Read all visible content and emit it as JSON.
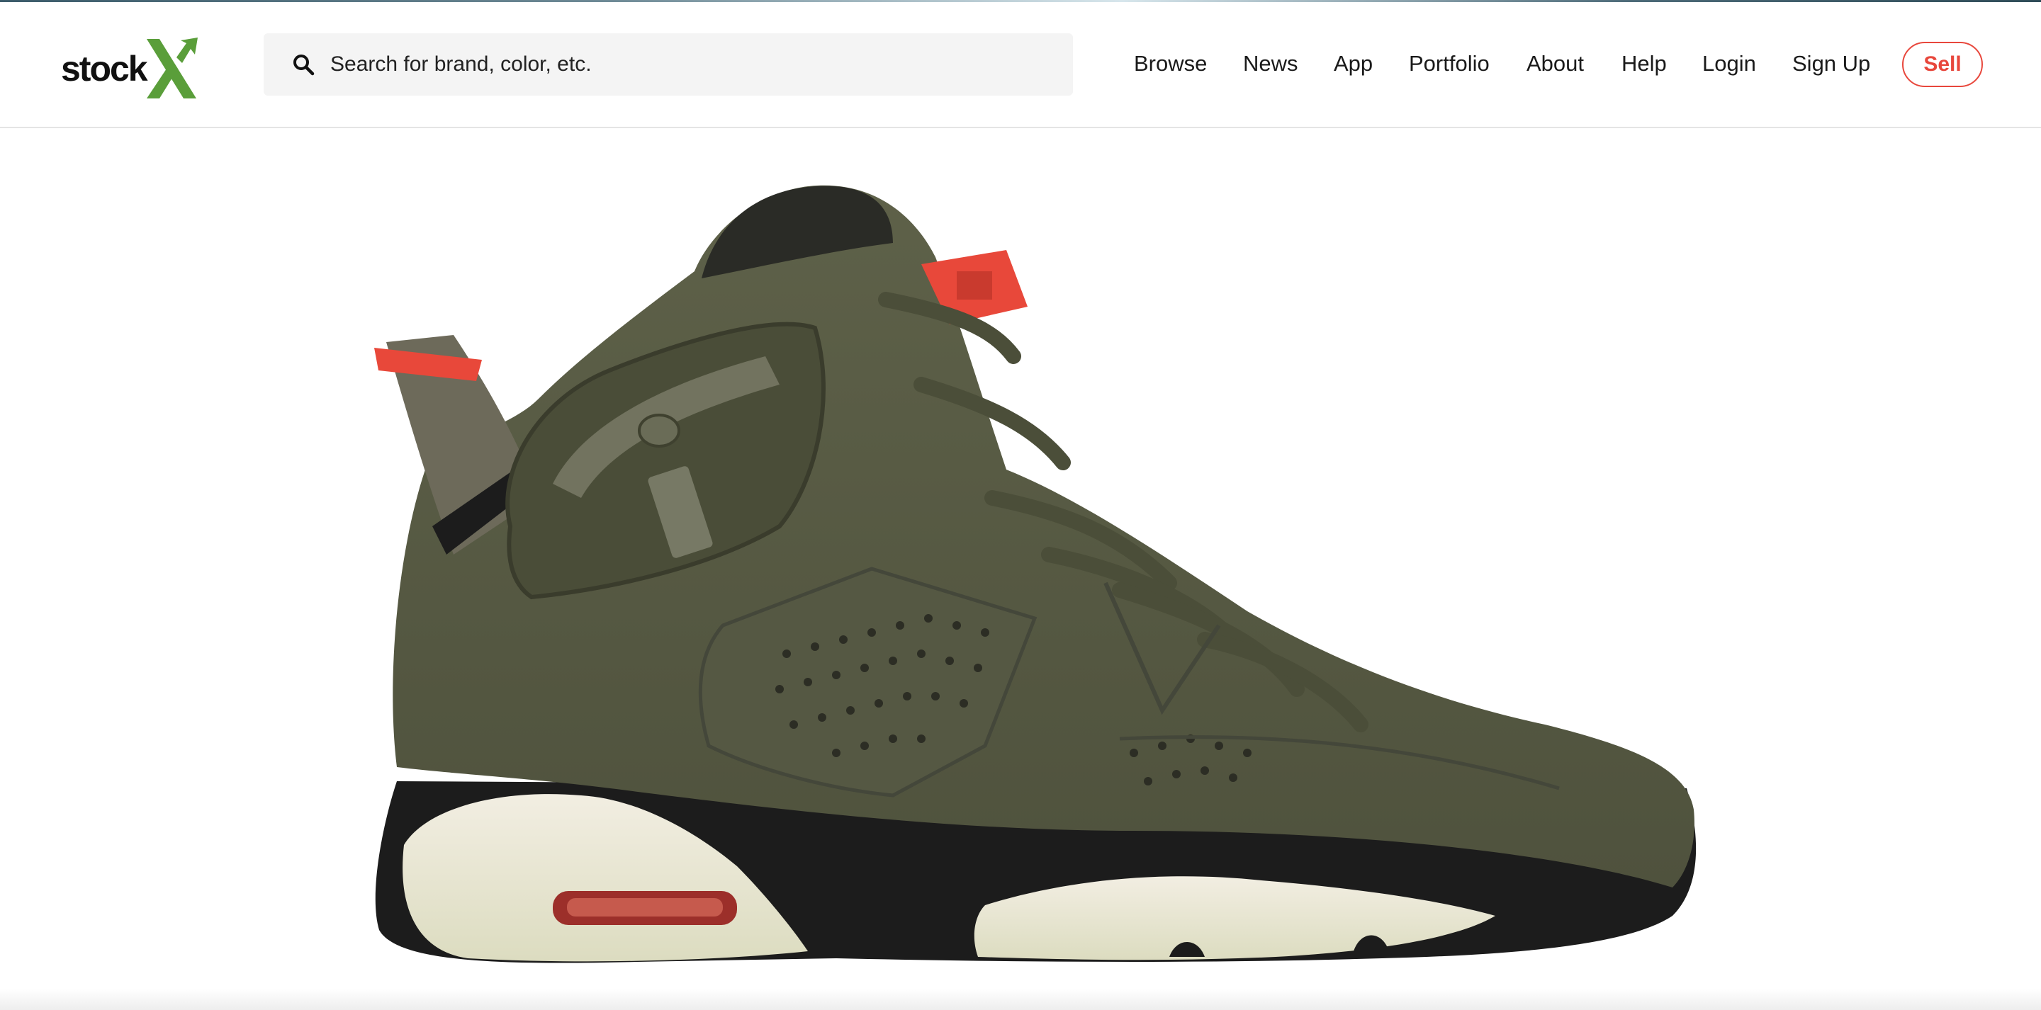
{
  "brand": {
    "logo_text": "stock",
    "logo_mark_color": "#5a9e3a",
    "accent_color": "#e8473c"
  },
  "search": {
    "placeholder": "Search for brand, color, etc.",
    "icon": "search-icon"
  },
  "nav": {
    "items": [
      {
        "label": "Browse"
      },
      {
        "label": "News"
      },
      {
        "label": "App"
      },
      {
        "label": "Portfolio"
      },
      {
        "label": "About"
      },
      {
        "label": "Help"
      },
      {
        "label": "Login"
      },
      {
        "label": "Sign Up"
      }
    ],
    "sell_label": "Sell"
  },
  "hero": {
    "image": "sneaker-product-image",
    "colors": {
      "upper": "#5b5e48",
      "sole_midsole": "#efeadc",
      "sole_black": "#1c1c1c",
      "accent_red": "#e8483a"
    }
  }
}
